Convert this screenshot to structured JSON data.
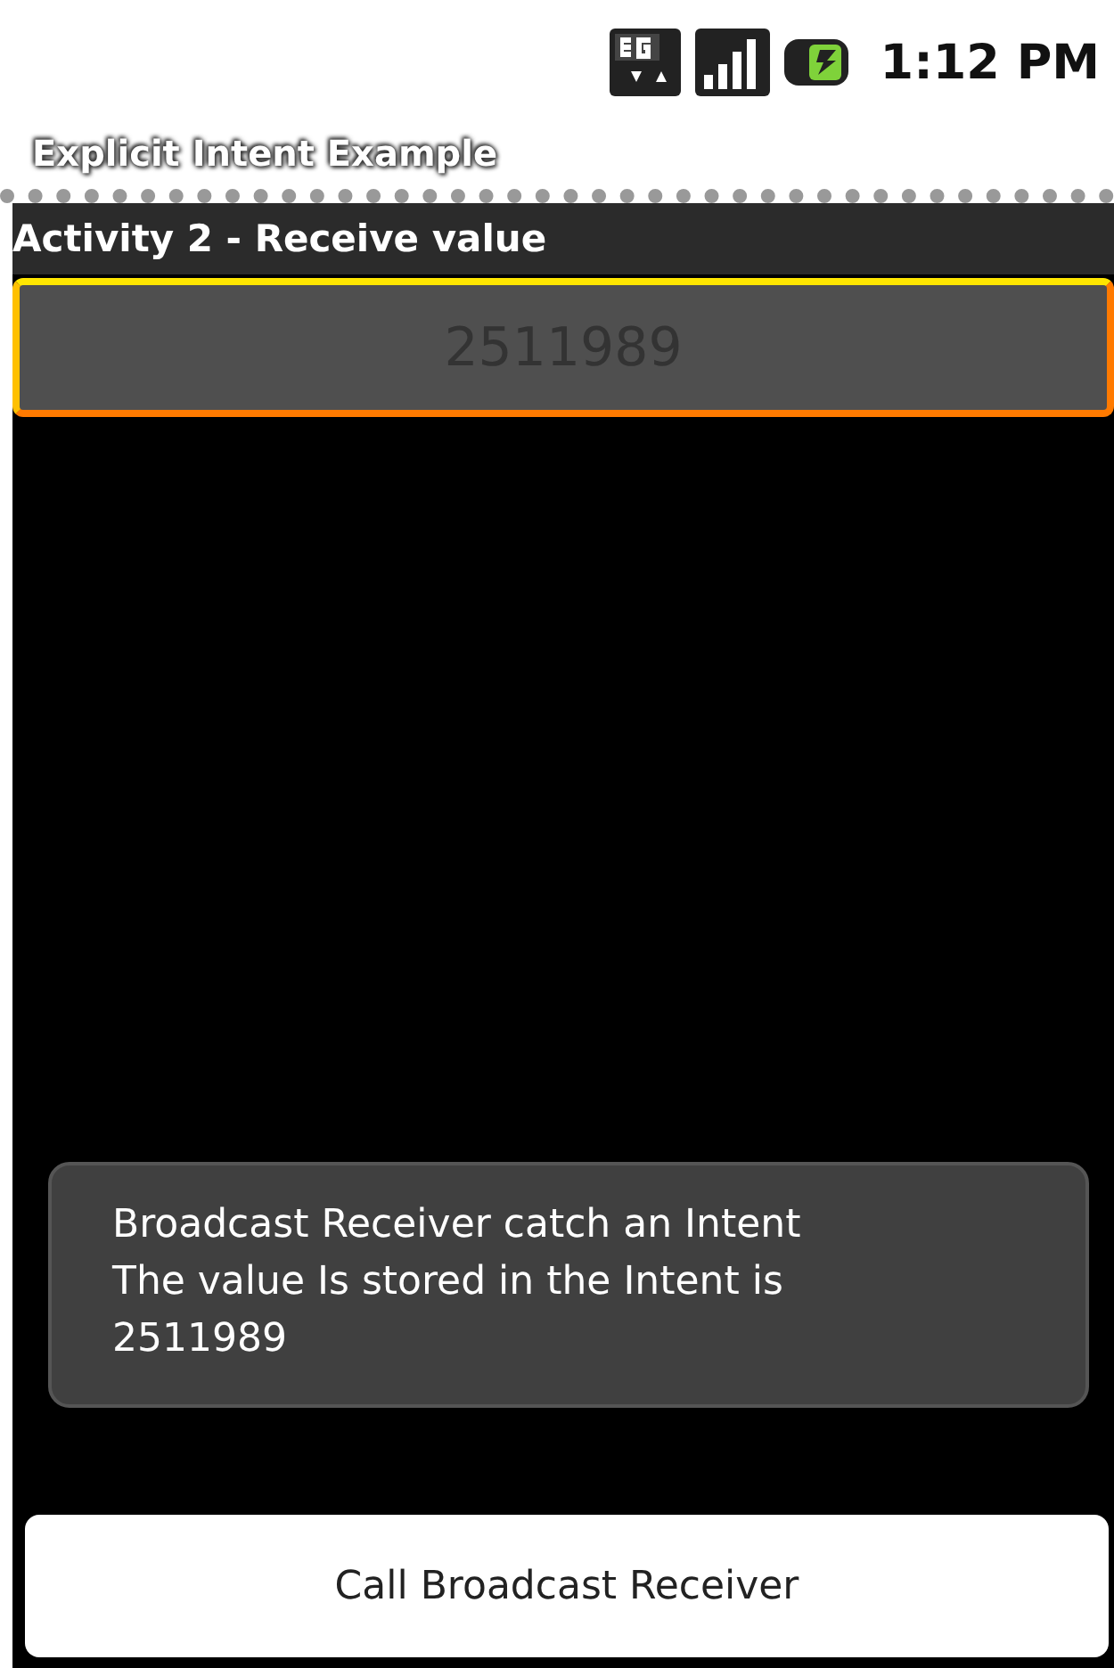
{
  "status_bar": {
    "time": "1:12 PM"
  },
  "app_title": "Explicit Intent Example",
  "activity_title": "Activity 2 - Receive value",
  "value_field": {
    "value": "2511989",
    "focused": true
  },
  "toast": {
    "lines": [
      "Broadcast Receiver catch an Intent",
      "The value Is stored in the Intent is 2511989"
    ]
  },
  "button": {
    "label": "Call Broadcast Receiver"
  }
}
